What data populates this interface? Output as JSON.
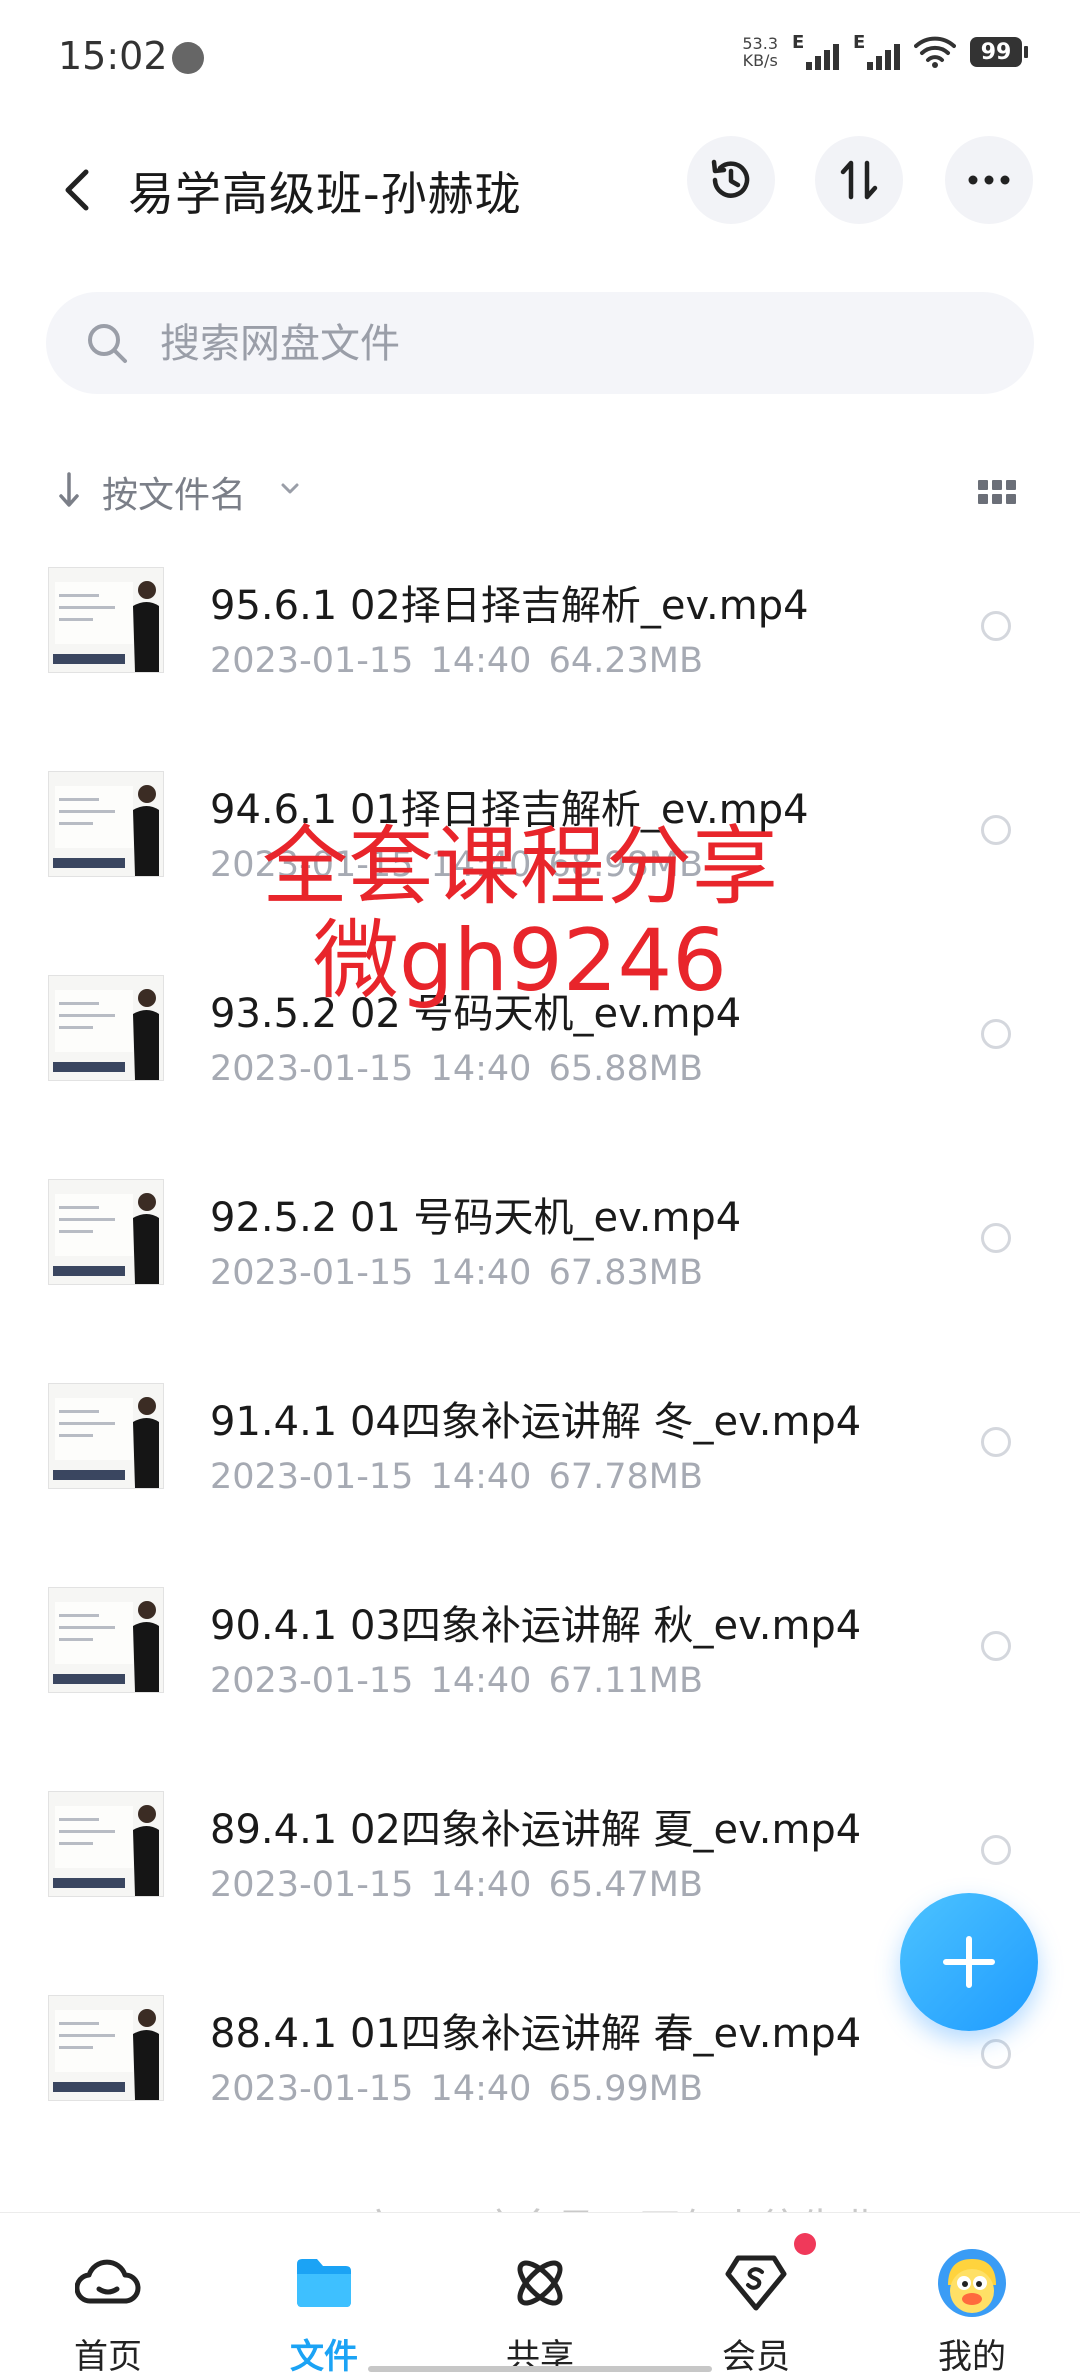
{
  "status_bar": {
    "time": "15:02",
    "net_speed_value": "53.3",
    "net_speed_unit": "KB/s",
    "signal_1_label": "E",
    "signal_2_label": "E",
    "battery": "99"
  },
  "header": {
    "title": "易学高级班-孙赫珑",
    "icons": [
      "back-icon",
      "history-icon",
      "sort-icon",
      "more-icon"
    ]
  },
  "search": {
    "placeholder": "搜索网盘文件"
  },
  "sort": {
    "label": "按文件名"
  },
  "files": [
    {
      "name": "95.6.1 02择日择吉解析_ev.mp4",
      "date": "2023-01-15",
      "time": "14:40",
      "size": "64.23MB"
    },
    {
      "name": "94.6.1 01择日择吉解析_ev.mp4",
      "date": "2023-01-15",
      "time": "14:40",
      "size": "68.98MB"
    },
    {
      "name": "93.5.2 02 号码天机_ev.mp4",
      "date": "2023-01-15",
      "time": "14:40",
      "size": "65.88MB"
    },
    {
      "name": "92.5.2 01 号码天机_ev.mp4",
      "date": "2023-01-15",
      "time": "14:40",
      "size": "67.83MB"
    },
    {
      "name": "91.4.1 04四象补运讲解 冬_ev.mp4",
      "date": "2023-01-15",
      "time": "14:40",
      "size": "67.78MB"
    },
    {
      "name": "90.4.1 03四象补运讲解 秋_ev.mp4",
      "date": "2023-01-15",
      "time": "14:40",
      "size": "67.11MB"
    },
    {
      "name": "89.4.1 02四象补运讲解 夏_ev.mp4",
      "date": "2023-01-15",
      "time": "14:40",
      "size": "65.47MB"
    },
    {
      "name": "88.4.1 01四象补运讲解 春_ev.mp4",
      "date": "2023-01-15",
      "time": "14:40",
      "size": "65.99MB"
    }
  ],
  "watermark": {
    "line1": "全套课程分享",
    "line2": "微gh9246"
  },
  "partial_text": "六四四之名及二万仁上往生业",
  "nav": {
    "items": [
      {
        "label": "首页",
        "icon": "home-cloud-icon"
      },
      {
        "label": "文件",
        "icon": "folder-icon"
      },
      {
        "label": "共享",
        "icon": "share-atom-icon"
      },
      {
        "label": "会员",
        "icon": "vip-diamond-icon"
      },
      {
        "label": "我的",
        "icon": "avatar-icon"
      }
    ],
    "active": "文件"
  },
  "colors": {
    "accent": "#1ba3f5",
    "watermark": "#e8252b",
    "fab": "#1f9bff",
    "badge": "#f0395a"
  }
}
